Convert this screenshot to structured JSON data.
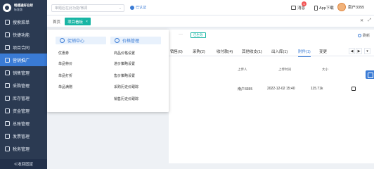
{
  "brand": {
    "name": "畅捷通好业财",
    "sub": "标准版"
  },
  "sidebar": {
    "items": [
      {
        "label": "搜索菜单",
        "icon": "search-icon"
      },
      {
        "label": "快捷功能",
        "icon": "flash-icon"
      },
      {
        "label": "项目合同",
        "icon": "contract-icon"
      },
      {
        "label": "营销推广",
        "icon": "megaphone-icon",
        "active": true
      },
      {
        "label": "销售管理",
        "icon": "sales-icon"
      },
      {
        "label": "采购管理",
        "icon": "cart-icon"
      },
      {
        "label": "库存管理",
        "icon": "box-icon"
      },
      {
        "label": "资金管理",
        "icon": "money-icon"
      },
      {
        "label": "总账管理",
        "icon": "ledger-icon"
      },
      {
        "label": "发票管理",
        "icon": "invoice-icon"
      },
      {
        "label": "税务管理",
        "icon": "tax-icon"
      }
    ],
    "collapse_label": "≪收回固定"
  },
  "header": {
    "search_placeholder": "审题后在此功能/微调",
    "verify_label": "已认证",
    "msg_label": "消息",
    "msg_badge": "1",
    "app_label": "App下载",
    "user_label": "南户3355"
  },
  "tabs": {
    "home": "首页",
    "active": "项目看板",
    "close": "×"
  },
  "panel": {
    "dots": "···",
    "status": "已生效",
    "refresh": "刷新",
    "subtabs": [
      "销售(0)",
      "采购(2)",
      "收付款(4)",
      "其他收支(1)",
      "出入库(1)",
      "附件(1)",
      "变更"
    ],
    "active_subtab_index": 5,
    "columns": [
      "上传人",
      "上传时间",
      "大小"
    ],
    "row": {
      "uploader": "南户3355",
      "time": "2022-12-02 15:40",
      "size": "115.71k"
    }
  },
  "dropdown": {
    "left_header": "促销中心",
    "right_header": "价格管理",
    "left_items": [
      "优惠券",
      "单品特价",
      "单品打折",
      "单品满赠"
    ],
    "right_items": [
      "商品价格设置",
      "进价策略设置",
      "售价策略设置",
      "采购历史价跟踪",
      "销售历史价跟踪"
    ]
  },
  "colors": {
    "sidebar": "#2b3a52",
    "accent": "#3a7bd5",
    "tab_active": "#18b5a4"
  }
}
